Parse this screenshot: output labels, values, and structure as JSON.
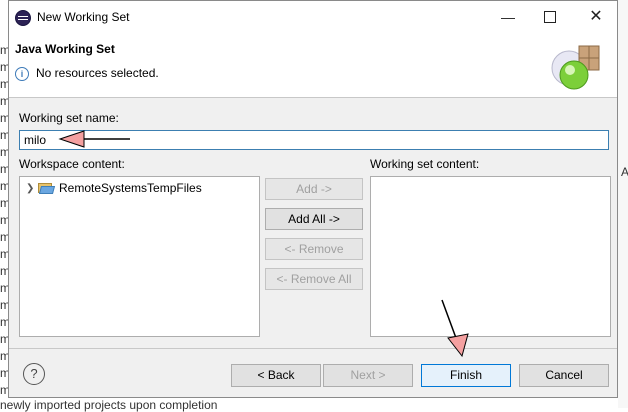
{
  "window": {
    "title": "New Working Set"
  },
  "header": {
    "title": "Java Working Set",
    "message": "No resources selected."
  },
  "form": {
    "name_label": "Working set name:",
    "name_value": "milo",
    "workspace_label": "Workspace content:",
    "working_set_label": "Working set content:"
  },
  "workspace_tree": [
    {
      "label": "RemoteSystemsTempFiles",
      "icon": "folder-icon",
      "expanded": false
    }
  ],
  "middle_buttons": {
    "add": "Add ->",
    "add_all": "Add All ->",
    "remove": "<- Remove",
    "remove_all": "<- Remove All"
  },
  "footer_buttons": {
    "back": "< Back",
    "next": "Next >",
    "finish": "Finish",
    "cancel": "Cancel"
  },
  "background": {
    "margin_char": "m",
    "bottom_text": "newly imported projects upon completion",
    "right_char": "A"
  },
  "colors": {
    "accent": "#0078d7",
    "annotation_arrow": "#f4a0a0",
    "input_border": "#3c7fb1"
  }
}
